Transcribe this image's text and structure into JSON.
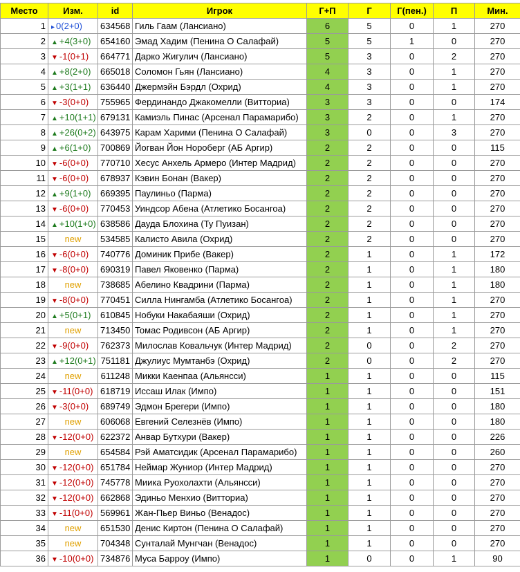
{
  "headers": [
    "Место",
    "Изм.",
    "id",
    "Игрок",
    "Г+П",
    "Г",
    "Г(пен.)",
    "П",
    "Мин."
  ],
  "colors": {
    "header_bg": "#ffff00",
    "gp_bg": "#92d050",
    "up": "#1e7b1e",
    "down": "#c00000",
    "same": "#1f4fd6",
    "new": "#e0a000"
  },
  "rows": [
    {
      "place": "1",
      "dir": "same",
      "change": "0(2+0)",
      "id": "634568",
      "player": "Гиль Гаам (Лансиано)",
      "gp": "6",
      "g": "5",
      "gpen": "0",
      "p": "1",
      "min": "270"
    },
    {
      "place": "2",
      "dir": "up",
      "change": "+4(3+0)",
      "id": "654160",
      "player": "Эмад Хадим (Пенина О Салафай)",
      "gp": "5",
      "g": "5",
      "gpen": "1",
      "p": "0",
      "min": "270"
    },
    {
      "place": "3",
      "dir": "down",
      "change": "-1(0+1)",
      "id": "664771",
      "player": "Дарко Жигулич (Лансиано)",
      "gp": "5",
      "g": "3",
      "gpen": "0",
      "p": "2",
      "min": "270"
    },
    {
      "place": "4",
      "dir": "up",
      "change": "+8(2+0)",
      "id": "665018",
      "player": "Соломон Гьян (Лансиано)",
      "gp": "4",
      "g": "3",
      "gpen": "0",
      "p": "1",
      "min": "270"
    },
    {
      "place": "5",
      "dir": "up",
      "change": "+3(1+1)",
      "id": "636440",
      "player": "Джермэйн Бэрдл (Охрид)",
      "gp": "4",
      "g": "3",
      "gpen": "0",
      "p": "1",
      "min": "270"
    },
    {
      "place": "6",
      "dir": "down",
      "change": "-3(0+0)",
      "id": "755965",
      "player": "Фердинандо Джакомелли (Витториа)",
      "gp": "3",
      "g": "3",
      "gpen": "0",
      "p": "0",
      "min": "174"
    },
    {
      "place": "7",
      "dir": "up",
      "change": "+10(1+1)",
      "id": "679131",
      "player": "Камиэль Пинас (Арсенал Парамарибо)",
      "gp": "3",
      "g": "2",
      "gpen": "0",
      "p": "1",
      "min": "270"
    },
    {
      "place": "8",
      "dir": "up",
      "change": "+26(0+2)",
      "id": "643975",
      "player": "Карам Харими (Пенина О Салафай)",
      "gp": "3",
      "g": "0",
      "gpen": "0",
      "p": "3",
      "min": "270"
    },
    {
      "place": "9",
      "dir": "up",
      "change": "+6(1+0)",
      "id": "700869",
      "player": "Йогван Йон Нороберг (АБ Аргир)",
      "gp": "2",
      "g": "2",
      "gpen": "0",
      "p": "0",
      "min": "115"
    },
    {
      "place": "10",
      "dir": "down",
      "change": "-6(0+0)",
      "id": "770710",
      "player": "Хесус Анхель Армеро (Интер Мадрид)",
      "gp": "2",
      "g": "2",
      "gpen": "0",
      "p": "0",
      "min": "270"
    },
    {
      "place": "11",
      "dir": "down",
      "change": "-6(0+0)",
      "id": "678937",
      "player": "Кэвин Бонан (Вакер)",
      "gp": "2",
      "g": "2",
      "gpen": "0",
      "p": "0",
      "min": "270"
    },
    {
      "place": "12",
      "dir": "up",
      "change": "+9(1+0)",
      "id": "669395",
      "player": "Паулиньо (Парма)",
      "gp": "2",
      "g": "2",
      "gpen": "0",
      "p": "0",
      "min": "270"
    },
    {
      "place": "13",
      "dir": "down",
      "change": "-6(0+0)",
      "id": "770453",
      "player": "Уиндсор Абена (Атлетико Босангоа)",
      "gp": "2",
      "g": "2",
      "gpen": "0",
      "p": "0",
      "min": "270"
    },
    {
      "place": "14",
      "dir": "up",
      "change": "+10(1+0)",
      "id": "638586",
      "player": "Дауда Блохина (Ту Пуизан)",
      "gp": "2",
      "g": "2",
      "gpen": "0",
      "p": "0",
      "min": "270"
    },
    {
      "place": "15",
      "dir": "new",
      "change": "new",
      "id": "534585",
      "player": "Калисто Авила (Охрид)",
      "gp": "2",
      "g": "2",
      "gpen": "0",
      "p": "0",
      "min": "270"
    },
    {
      "place": "16",
      "dir": "down",
      "change": "-6(0+0)",
      "id": "740776",
      "player": "Доминик Прибе (Вакер)",
      "gp": "2",
      "g": "1",
      "gpen": "0",
      "p": "1",
      "min": "172"
    },
    {
      "place": "17",
      "dir": "down",
      "change": "-8(0+0)",
      "id": "690319",
      "player": "Павел Яковенко (Парма)",
      "gp": "2",
      "g": "1",
      "gpen": "0",
      "p": "1",
      "min": "180"
    },
    {
      "place": "18",
      "dir": "new",
      "change": "new",
      "id": "738685",
      "player": "Абелино Квадрини (Парма)",
      "gp": "2",
      "g": "1",
      "gpen": "0",
      "p": "1",
      "min": "180"
    },
    {
      "place": "19",
      "dir": "down",
      "change": "-8(0+0)",
      "id": "770451",
      "player": "Силла Нингамба (Атлетико Босангоа)",
      "gp": "2",
      "g": "1",
      "gpen": "0",
      "p": "1",
      "min": "270"
    },
    {
      "place": "20",
      "dir": "up",
      "change": "+5(0+1)",
      "id": "610845",
      "player": "Нобуки Накабаяши (Охрид)",
      "gp": "2",
      "g": "1",
      "gpen": "0",
      "p": "1",
      "min": "270"
    },
    {
      "place": "21",
      "dir": "new",
      "change": "new",
      "id": "713450",
      "player": "Томас Родивсон (АБ Аргир)",
      "gp": "2",
      "g": "1",
      "gpen": "0",
      "p": "1",
      "min": "270"
    },
    {
      "place": "22",
      "dir": "down",
      "change": "-9(0+0)",
      "id": "762373",
      "player": "Милослав Ковальчук (Интер Мадрид)",
      "gp": "2",
      "g": "0",
      "gpen": "0",
      "p": "2",
      "min": "270"
    },
    {
      "place": "23",
      "dir": "up",
      "change": "+12(0+1)",
      "id": "751181",
      "player": "Джулиус Мумтанбэ (Охрид)",
      "gp": "2",
      "g": "0",
      "gpen": "0",
      "p": "2",
      "min": "270"
    },
    {
      "place": "24",
      "dir": "new",
      "change": "new",
      "id": "611248",
      "player": "Микки Каенпаа (Альянсси)",
      "gp": "1",
      "g": "1",
      "gpen": "0",
      "p": "0",
      "min": "115"
    },
    {
      "place": "25",
      "dir": "down",
      "change": "-11(0+0)",
      "id": "618719",
      "player": "Иссаш Илак (Импо)",
      "gp": "1",
      "g": "1",
      "gpen": "0",
      "p": "0",
      "min": "151"
    },
    {
      "place": "26",
      "dir": "down",
      "change": "-3(0+0)",
      "id": "689749",
      "player": "Эдмон Брегери (Импо)",
      "gp": "1",
      "g": "1",
      "gpen": "0",
      "p": "0",
      "min": "180"
    },
    {
      "place": "27",
      "dir": "new",
      "change": "new",
      "id": "606068",
      "player": "Евгений Селезнёв (Импо)",
      "gp": "1",
      "g": "1",
      "gpen": "0",
      "p": "0",
      "min": "180"
    },
    {
      "place": "28",
      "dir": "down",
      "change": "-12(0+0)",
      "id": "622372",
      "player": "Анвар Бутхури (Вакер)",
      "gp": "1",
      "g": "1",
      "gpen": "0",
      "p": "0",
      "min": "226"
    },
    {
      "place": "29",
      "dir": "new",
      "change": "new",
      "id": "654584",
      "player": "Рэй Аматсидик (Арсенал Парамарибо)",
      "gp": "1",
      "g": "1",
      "gpen": "0",
      "p": "0",
      "min": "260"
    },
    {
      "place": "30",
      "dir": "down",
      "change": "-12(0+0)",
      "id": "651784",
      "player": "Неймар Жуниор (Интер Мадрид)",
      "gp": "1",
      "g": "1",
      "gpen": "0",
      "p": "0",
      "min": "270"
    },
    {
      "place": "31",
      "dir": "down",
      "change": "-12(0+0)",
      "id": "745778",
      "player": "Миика Руохолахти (Альянсси)",
      "gp": "1",
      "g": "1",
      "gpen": "0",
      "p": "0",
      "min": "270"
    },
    {
      "place": "32",
      "dir": "down",
      "change": "-12(0+0)",
      "id": "662868",
      "player": "Эдиньо Менхио (Витториа)",
      "gp": "1",
      "g": "1",
      "gpen": "0",
      "p": "0",
      "min": "270"
    },
    {
      "place": "33",
      "dir": "down",
      "change": "-11(0+0)",
      "id": "569961",
      "player": "Жан-Пьер Виньо (Венадос)",
      "gp": "1",
      "g": "1",
      "gpen": "0",
      "p": "0",
      "min": "270"
    },
    {
      "place": "34",
      "dir": "new",
      "change": "new",
      "id": "651530",
      "player": "Денис Киртон (Пенина О Салафай)",
      "gp": "1",
      "g": "1",
      "gpen": "0",
      "p": "0",
      "min": "270"
    },
    {
      "place": "35",
      "dir": "new",
      "change": "new",
      "id": "704348",
      "player": "Сунталай Мунгчан (Венадос)",
      "gp": "1",
      "g": "1",
      "gpen": "0",
      "p": "0",
      "min": "270"
    },
    {
      "place": "36",
      "dir": "down",
      "change": "-10(0+0)",
      "id": "734876",
      "player": "Муса Барроу (Импо)",
      "gp": "1",
      "g": "0",
      "gpen": "0",
      "p": "1",
      "min": "90"
    }
  ]
}
